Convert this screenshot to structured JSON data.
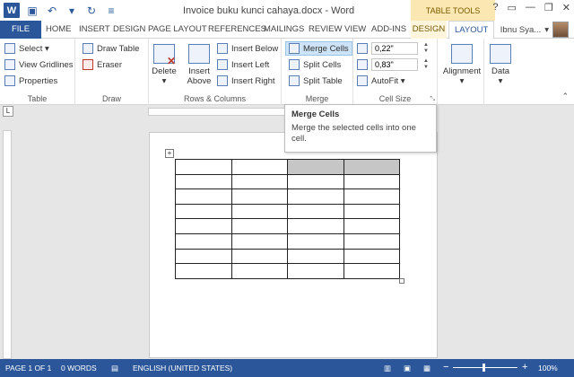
{
  "titlebar": {
    "app_icon": "W",
    "title": "Invoice buku kunci cahaya.docx - Word",
    "table_tools": "TABLE TOOLS",
    "help": "?",
    "minimize": "—",
    "restore": "❐",
    "close": "✕"
  },
  "tabs": [
    "FILE",
    "HOME",
    "INSERT",
    "DESIGN",
    "PAGE LAYOUT",
    "REFERENCES",
    "MAILINGS",
    "REVIEW",
    "VIEW",
    "ADD-INS",
    "DESIGN",
    "LAYOUT"
  ],
  "user_name": "Ibnu Sya...",
  "ribbon": {
    "table": {
      "select": "Select ▾",
      "gridlines": "View Gridlines",
      "properties": "Properties",
      "label": "Table"
    },
    "draw": {
      "draw_table": "Draw Table",
      "eraser": "Eraser",
      "label": "Draw"
    },
    "rows_cols": {
      "delete": "Delete",
      "delete_arrow": "▾",
      "insert_above_1": "Insert",
      "insert_above_2": "Above",
      "insert_below": "Insert Below",
      "insert_left": "Insert Left",
      "insert_right": "Insert Right",
      "label": "Rows & Columns"
    },
    "merge": {
      "merge_cells": "Merge Cells",
      "split_cells": "Split Cells",
      "split_table": "Split Table",
      "label": "Merge"
    },
    "cell_size": {
      "height": "0,22\"",
      "width": "0,83\"",
      "autofit": "AutoFit ▾",
      "label": "Cell Size"
    },
    "alignment": {
      "label": "Alignment"
    },
    "data": {
      "label": "Data"
    }
  },
  "tooltip": {
    "title": "Merge Cells",
    "body": "Merge the selected cells into one cell."
  },
  "status": {
    "page": "PAGE 1 OF 1",
    "words": "0 WORDS",
    "language": "ENGLISH (UNITED STATES)",
    "zoom_minus": "−",
    "zoom_plus": "+",
    "zoom": "100%"
  },
  "table": {
    "rows": 8,
    "cols": 4,
    "selected": [
      [
        0,
        2
      ],
      [
        0,
        3
      ]
    ]
  },
  "colors": {
    "accent": "#2b579a",
    "table_tools": "#fbe7b1",
    "selected_cell": "#c6c6c6",
    "hover": "#cde3f7"
  }
}
